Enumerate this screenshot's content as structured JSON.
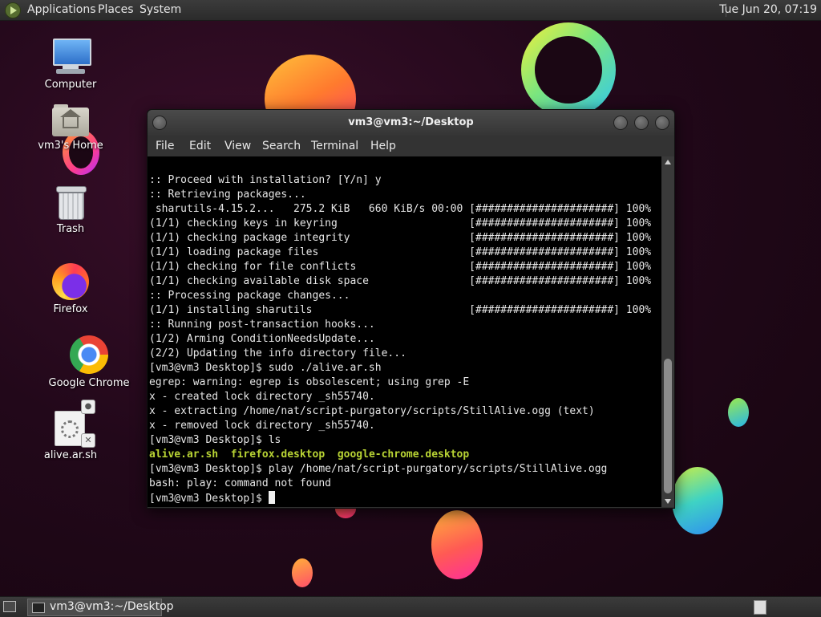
{
  "top_panel": {
    "menus": [
      "Applications",
      "Places",
      "System"
    ],
    "clock": "Tue Jun 20, 07:19"
  },
  "desktop_icons": {
    "computer": "Computer",
    "home": "vm3's Home",
    "trash": "Trash",
    "firefox": "Firefox",
    "chrome": "Google Chrome",
    "script": "alive.ar.sh"
  },
  "terminal": {
    "title": "vm3@vm3:~/Desktop",
    "menu": [
      "File",
      "Edit",
      "View",
      "Search",
      "Terminal",
      "Help"
    ],
    "lines": [
      ":: Proceed with installation? [Y/n] y",
      ":: Retrieving packages...",
      " sharutils-4.15.2...   275.2 KiB   660 KiB/s 00:00 [######################] 100%",
      "(1/1) checking keys in keyring                     [######################] 100%",
      "(1/1) checking package integrity                   [######################] 100%",
      "(1/1) loading package files                        [######################] 100%",
      "(1/1) checking for file conflicts                  [######################] 100%",
      "(1/1) checking available disk space                [######################] 100%",
      ":: Processing package changes...",
      "(1/1) installing sharutils                         [######################] 100%",
      ":: Running post-transaction hooks...",
      "(1/2) Arming ConditionNeedsUpdate...",
      "(2/2) Updating the info directory file...",
      "[vm3@vm3 Desktop]$ sudo ./alive.ar.sh",
      "egrep: warning: egrep is obsolescent; using grep -E",
      "x - created lock directory _sh55740.",
      "x - extracting /home/nat/script-purgatory/scripts/StillAlive.ogg (text)",
      "x - removed lock directory _sh55740.",
      "[vm3@vm3 Desktop]$ ls"
    ],
    "ls_files": [
      "alive.ar.sh",
      "firefox.desktop",
      "google-chrome.desktop"
    ],
    "lines_after": [
      "[vm3@vm3 Desktop]$ play /home/nat/script-purgatory/scripts/StillAlive.ogg",
      "bash: play: command not found"
    ],
    "prompt": "[vm3@vm3 Desktop]$ "
  },
  "taskbar": {
    "task_label": "vm3@vm3:~/Desktop"
  },
  "colors": {
    "ls_file_color": "#b8d334",
    "terminal_bg": "#000000",
    "panel_bg": "#2f2f2f"
  }
}
